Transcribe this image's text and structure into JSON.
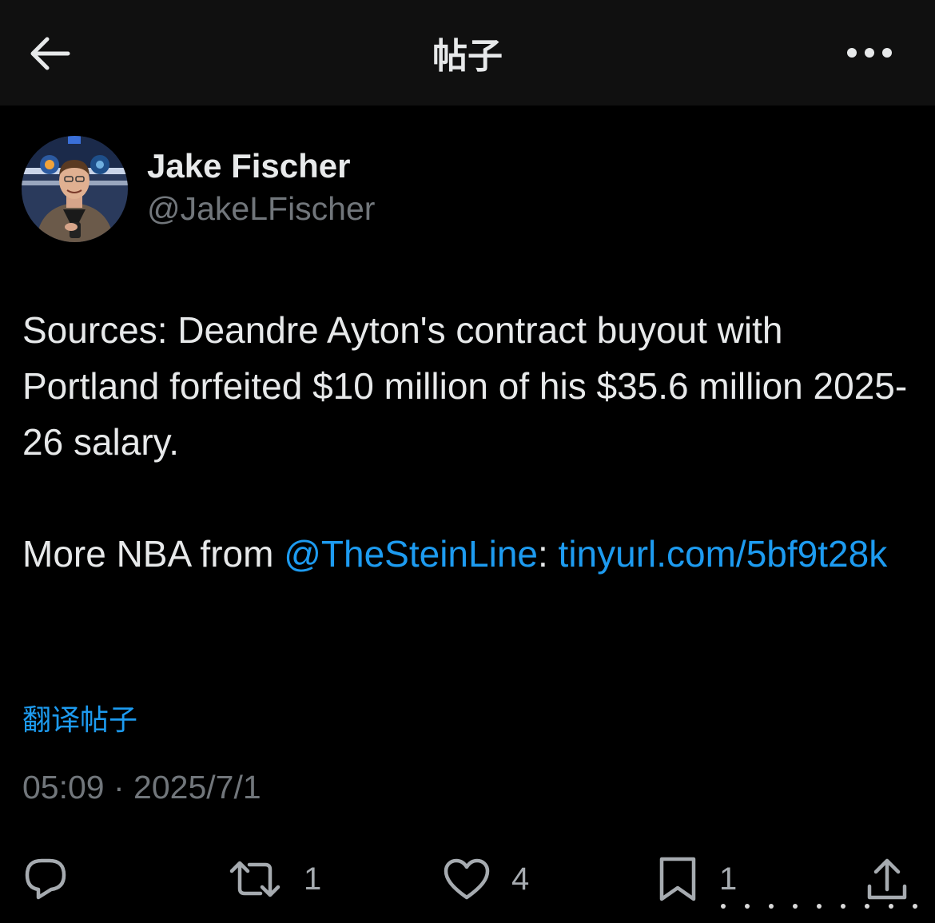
{
  "header": {
    "title": "帖子",
    "back_icon": "arrow-left-icon",
    "more_icon": "more-horizontal-icon"
  },
  "author": {
    "name": "Jake Fischer",
    "handle": "@JakeLFischer",
    "avatar_icon": "user-avatar"
  },
  "post": {
    "text_line": "Sources: Deandre Ayton's contract buyout with Portland forfeited $10 million of his $35.6 million 2025-26 salary.",
    "more_prefix": "More NBA from ",
    "mention": "@TheSteinLine",
    "colon": ": ",
    "link": "tinyurl.com/5bf9t28k"
  },
  "translate_label": "翻译帖子",
  "timestamp": {
    "time": "05:09",
    "separator": " · ",
    "date": "2025/7/1"
  },
  "actions": {
    "reply": {
      "icon": "reply-icon",
      "count": ""
    },
    "repost": {
      "icon": "repost-icon",
      "count": "1"
    },
    "like": {
      "icon": "heart-icon",
      "count": "4"
    },
    "bookmark": {
      "icon": "bookmark-icon",
      "count": "1"
    },
    "share": {
      "icon": "share-icon"
    }
  },
  "colors": {
    "background": "#000000",
    "header_bg": "#101010",
    "text": "#e7e9ea",
    "muted": "#71767b",
    "link": "#1d9bf0"
  }
}
